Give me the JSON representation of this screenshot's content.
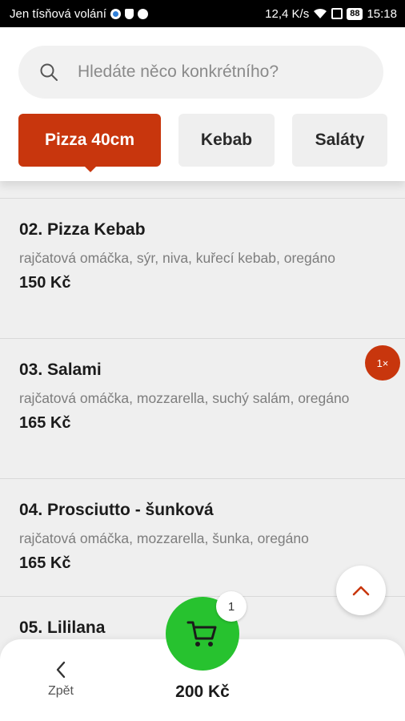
{
  "status_bar": {
    "carrier": "Jen tísňová volání",
    "speed": "12,4 K/s",
    "battery": "88",
    "time": "15:18"
  },
  "search": {
    "placeholder": "Hledáte něco konkrétního?"
  },
  "categories": [
    {
      "label": "Pizza 40cm",
      "active": true
    },
    {
      "label": "Kebab",
      "active": false
    },
    {
      "label": "Saláty",
      "active": false
    }
  ],
  "items": [
    {
      "name": "02. Pizza Kebab",
      "desc": "rajčatová omáčka, sýr, niva, kuřecí kebab, oregáno",
      "price": "150 Kč"
    },
    {
      "name": "03. Salami",
      "desc": "rajčatová omáčka, mozzarella, suchý salám, oregáno",
      "price": "165 Kč",
      "qty": "1×"
    },
    {
      "name": "04. Prosciutto - šunková",
      "desc": "rajčatová omáčka, mozzarella, šunka, oregáno",
      "price": "165 Kč"
    },
    {
      "name": "05. Lililana"
    }
  ],
  "bottom": {
    "back_label": "Zpět",
    "total": "200 Kč",
    "cart_count": "1"
  },
  "colors": {
    "accent": "#c8360d",
    "cart": "#27c22f"
  }
}
